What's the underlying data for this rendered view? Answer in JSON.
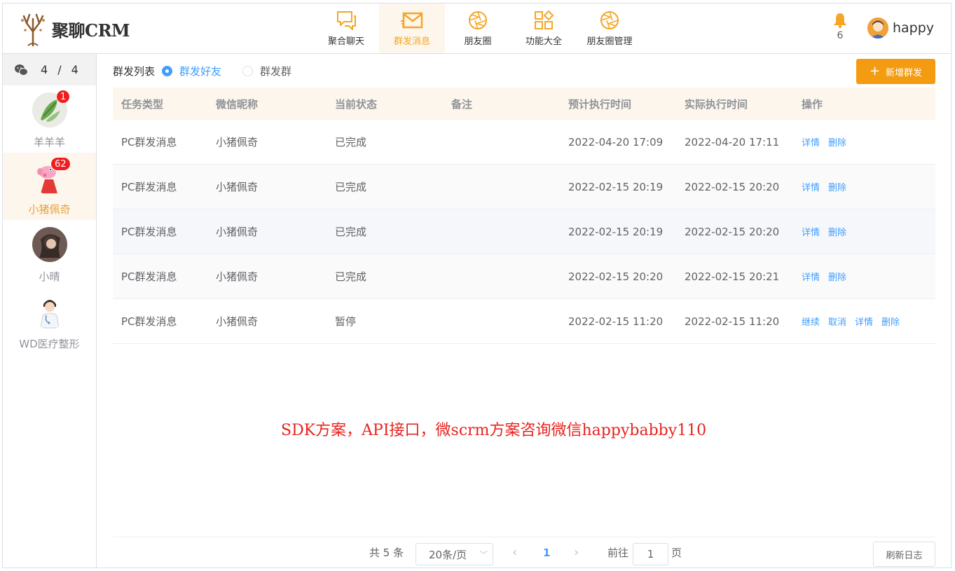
{
  "app": {
    "logo_text": "聚聊CRM"
  },
  "nav": [
    {
      "label": "聚合聊天",
      "icon": "chat-bubbles-icon"
    },
    {
      "label": "群发消息",
      "icon": "envelope-icon",
      "active": true
    },
    {
      "label": "朋友圈",
      "icon": "aperture-icon"
    },
    {
      "label": "功能大全",
      "icon": "grid-apps-icon"
    },
    {
      "label": "朋友圈管理",
      "icon": "aperture-icon"
    }
  ],
  "header": {
    "bell_count": "6",
    "user_name": "happy"
  },
  "sidebar": {
    "count_current": "4",
    "count_sep": "/",
    "count_total": "4",
    "contacts": [
      {
        "name": "羊羊羊",
        "badge": "1"
      },
      {
        "name": "小猪佩奇",
        "badge": "62",
        "active": true
      },
      {
        "name": "小晴",
        "badge": ""
      },
      {
        "name": "WD医疗整形",
        "badge": ""
      }
    ]
  },
  "toolbar": {
    "title": "群发列表",
    "radio_friends": "群发好友",
    "radio_groups": "群发群",
    "add_label": "新增群发"
  },
  "table": {
    "headers": [
      "任务类型",
      "微信昵称",
      "当前状态",
      "备注",
      "预计执行时间",
      "实际执行时间",
      "操作"
    ],
    "rows": [
      {
        "type": "PC群发消息",
        "nick": "小猪佩奇",
        "status": "已完成",
        "note": "",
        "plan": "2022-04-20 17:09",
        "actual": "2022-04-20 17:11",
        "ops": [
          "详情",
          "删除"
        ]
      },
      {
        "type": "PC群发消息",
        "nick": "小猪佩奇",
        "status": "已完成",
        "note": "",
        "plan": "2022-02-15 20:19",
        "actual": "2022-02-15 20:20",
        "ops": [
          "详情",
          "删除"
        ]
      },
      {
        "type": "PC群发消息",
        "nick": "小猪佩奇",
        "status": "已完成",
        "note": "",
        "plan": "2022-02-15 20:19",
        "actual": "2022-02-15 20:20",
        "ops": [
          "详情",
          "删除"
        ]
      },
      {
        "type": "PC群发消息",
        "nick": "小猪佩奇",
        "status": "已完成",
        "note": "",
        "plan": "2022-02-15 20:20",
        "actual": "2022-02-15 20:21",
        "ops": [
          "详情",
          "删除"
        ]
      },
      {
        "type": "PC群发消息",
        "nick": "小猪佩奇",
        "status": "暂停",
        "note": "",
        "plan": "2022-02-15 11:20",
        "actual": "2022-02-15 11:20",
        "ops": [
          "继续",
          "取消",
          "详情",
          "删除"
        ]
      }
    ]
  },
  "watermark": "SDK方案，API接口，微scrm方案咨询微信happybabby110",
  "pager": {
    "total": "共 5 条",
    "page_size": "20条/页",
    "current": "1",
    "goto_label": "前往",
    "goto_value": "1",
    "page_unit": "页",
    "refresh_label": "刷新日志"
  },
  "colors": {
    "accent": "#f39c12",
    "link": "#409eff",
    "badge": "#f01e1e",
    "header_bg": "#fdf6ec"
  }
}
